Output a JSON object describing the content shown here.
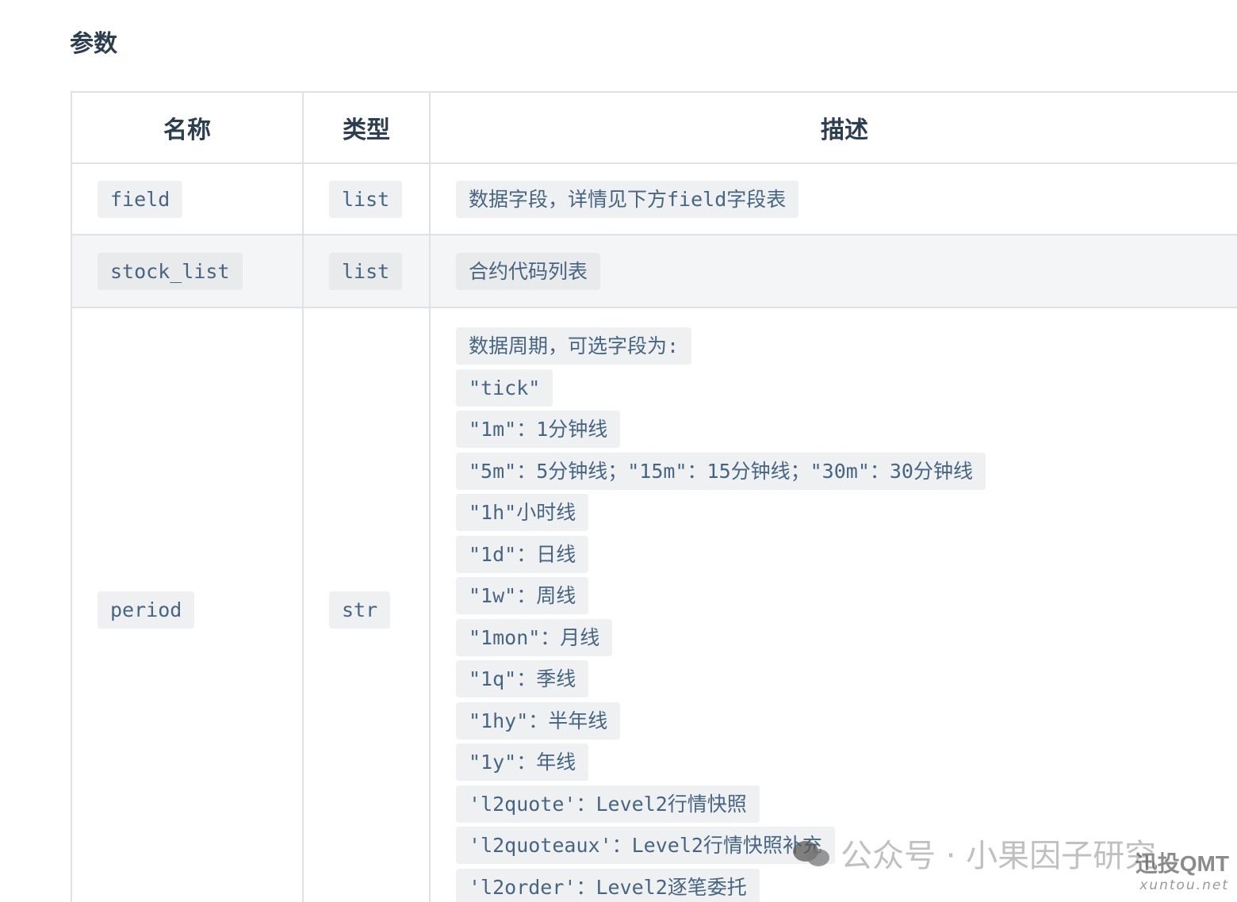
{
  "section": {
    "title": "参数"
  },
  "table": {
    "headers": {
      "name": "名称",
      "type": "类型",
      "desc": "描述"
    },
    "rows": [
      {
        "name": "field",
        "type": "list",
        "desc": "数据字段，详情见下方field字段表"
      },
      {
        "name": "stock_list",
        "type": "list",
        "desc": "合约代码列表"
      },
      {
        "name": "period",
        "type": "str",
        "desc_lines": [
          "数据周期，可选字段为:",
          "\"tick\"",
          "\"1m\"：1分钟线",
          "\"5m\"：5分钟线；\"15m\"：15分钟线；\"30m\"：30分钟线",
          "\"1h\"小时线",
          "\"1d\"：日线",
          "\"1w\"：周线",
          "\"1mon\"：月线",
          "\"1q\"：季线",
          "\"1hy\"：半年线",
          "\"1y\"：年线",
          "'l2quote'：Level2行情快照",
          "'l2quoteaux'：Level2行情快照补充",
          "'l2order'：Level2逐笔委托"
        ]
      }
    ]
  },
  "watermark": {
    "icon": "wechat-icon",
    "text": "公众号 · 小果因子研究",
    "brand": "迅投QMT",
    "url": "xuntou.net"
  }
}
